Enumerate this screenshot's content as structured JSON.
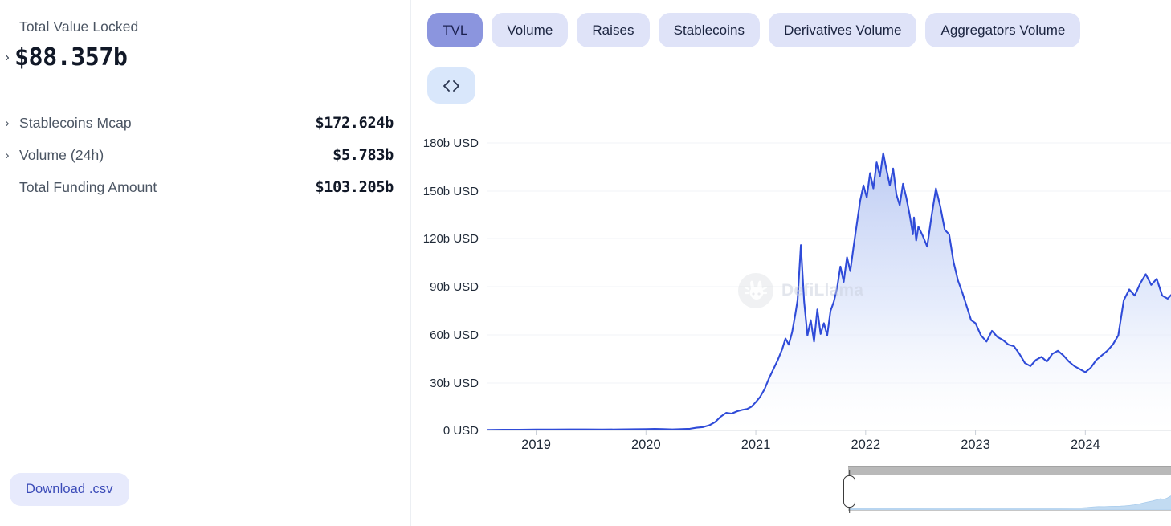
{
  "sidebar": {
    "hero": {
      "label": "Total Value Locked",
      "value": "$88.357b",
      "chevron": "›"
    },
    "stats": [
      {
        "chevron": "›",
        "name": "Stablecoins Mcap",
        "value": "$172.624b",
        "expandable": true
      },
      {
        "chevron": "›",
        "name": "Volume (24h)",
        "value": "$5.783b",
        "expandable": true
      },
      {
        "chevron": "",
        "name": "Total Funding Amount",
        "value": "$103.205b",
        "expandable": false
      }
    ],
    "download_label": "Download .csv"
  },
  "tabs": [
    {
      "label": "TVL",
      "active": true
    },
    {
      "label": "Volume",
      "active": false
    },
    {
      "label": "Raises",
      "active": false
    },
    {
      "label": "Stablecoins",
      "active": false
    },
    {
      "label": "Derivatives Volume",
      "active": false
    },
    {
      "label": "Aggregators Volume",
      "active": false
    }
  ],
  "embed_button": {
    "icon": "code-icon",
    "glyph": "‹›"
  },
  "watermark": {
    "text": "DefiLlama"
  },
  "datazoom": {
    "start_pct": 0,
    "end_pct": 100,
    "left_handle": "datazoom-left-handle",
    "right_handle": "datazoom-right-handle"
  },
  "colors": {
    "line": "#2f4bd8",
    "area_top": "#c3d0f5",
    "area_bottom": "#ffffff",
    "tab_active_bg": "#8b95de",
    "tab_bg": "#dfe3f8",
    "accent": "#3b4bb8",
    "grid": "#f1f3f7"
  },
  "chart_data": {
    "type": "area",
    "title": "",
    "xlabel": "",
    "ylabel": "USD",
    "ylim": [
      0,
      195
    ],
    "grid": true,
    "legend": "none",
    "unit": "b USD",
    "ytick_labels": [
      "180b USD",
      "150b USD",
      "120b USD",
      "90b USD",
      "60b USD",
      "30b USD",
      "0 USD"
    ],
    "ytick_values": [
      180,
      150,
      120,
      90,
      60,
      30,
      0
    ],
    "xtick_labels": [
      "2019",
      "2020",
      "2021",
      "2022",
      "2023",
      "2024"
    ],
    "xtick_values": [
      2019,
      2020,
      2021,
      2022,
      2023,
      2024
    ],
    "x_range": [
      2018.55,
      2024.78
    ],
    "series": [
      {
        "name": "Total Value Locked",
        "x": [
          2018.55,
          2018.7,
          2018.85,
          2019.0,
          2019.15,
          2019.3,
          2019.45,
          2019.6,
          2019.75,
          2019.9,
          2020.0,
          2020.08,
          2020.16,
          2020.24,
          2020.32,
          2020.4,
          2020.46,
          2020.52,
          2020.58,
          2020.63,
          2020.68,
          2020.73,
          2020.78,
          2020.83,
          2020.88,
          2020.92,
          2020.96,
          2021.0,
          2021.04,
          2021.08,
          2021.12,
          2021.16,
          2021.2,
          2021.24,
          2021.27,
          2021.3,
          2021.33,
          2021.36,
          2021.38,
          2021.41,
          2021.44,
          2021.47,
          2021.5,
          2021.53,
          2021.56,
          2021.59,
          2021.62,
          2021.65,
          2021.68,
          2021.71,
          2021.74,
          2021.77,
          2021.8,
          2021.83,
          2021.86,
          2021.89,
          2021.92,
          2021.95,
          2021.98,
          2022.01,
          2022.04,
          2022.07,
          2022.1,
          2022.13,
          2022.16,
          2022.19,
          2022.22,
          2022.25,
          2022.28,
          2022.31,
          2022.34,
          2022.37,
          2022.4,
          2022.43,
          2022.44,
          2022.46,
          2022.48,
          2022.52,
          2022.56,
          2022.6,
          2022.64,
          2022.68,
          2022.72,
          2022.76,
          2022.8,
          2022.84,
          2022.88,
          2022.92,
          2022.96,
          2023.0,
          2023.05,
          2023.1,
          2023.15,
          2023.2,
          2023.25,
          2023.3,
          2023.35,
          2023.4,
          2023.45,
          2023.5,
          2023.55,
          2023.6,
          2023.65,
          2023.7,
          2023.75,
          2023.8,
          2023.85,
          2023.9,
          2023.95,
          2024.0,
          2024.05,
          2024.1,
          2024.15,
          2024.2,
          2024.25,
          2024.3,
          2024.35,
          2024.4,
          2024.45,
          2024.5,
          2024.55,
          2024.6,
          2024.65,
          2024.7,
          2024.75,
          2024.78
        ],
        "y": [
          0.4,
          0.5,
          0.5,
          0.6,
          0.6,
          0.7,
          0.7,
          0.6,
          0.7,
          0.8,
          0.9,
          1.0,
          0.9,
          0.7,
          0.9,
          1.1,
          1.8,
          2.2,
          3.5,
          5.5,
          9.0,
          11.5,
          11.0,
          12.5,
          13.5,
          14.0,
          15.5,
          18.5,
          22.0,
          27.0,
          34.0,
          40.0,
          46.0,
          53.0,
          60.0,
          56.0,
          64.0,
          76.0,
          85.0,
          121.0,
          84.0,
          62.0,
          72.0,
          58.0,
          79.0,
          63.0,
          70.0,
          62.0,
          78.0,
          84.0,
          93.0,
          107.0,
          97.0,
          113.0,
          104.0,
          120.0,
          135.0,
          150.0,
          160.0,
          152.0,
          168.0,
          158.0,
          175.0,
          166.0,
          181.0,
          170.0,
          160.0,
          171.0,
          154.0,
          147.0,
          161.0,
          152.0,
          141.0,
          128.0,
          139.0,
          124.0,
          133.0,
          127.0,
          120.0,
          140.0,
          158.0,
          146.0,
          131.0,
          128.0,
          110.0,
          98.0,
          90.0,
          81.0,
          72.0,
          70.0,
          62.0,
          58.0,
          65.0,
          61.0,
          59.0,
          56.0,
          55.0,
          50.0,
          44.0,
          42.0,
          46.0,
          48.0,
          45.0,
          50.0,
          52.0,
          49.0,
          45.0,
          42.0,
          40.0,
          38.0,
          41.0,
          46.0,
          49.0,
          52.0,
          56.0,
          62.0,
          85.0,
          92.0,
          88.0,
          96.0,
          102.0,
          95.0,
          99.0,
          88.0,
          86.0,
          88.36
        ]
      }
    ],
    "annotations": [
      {
        "text": "DefiLlama",
        "type": "watermark"
      }
    ]
  }
}
